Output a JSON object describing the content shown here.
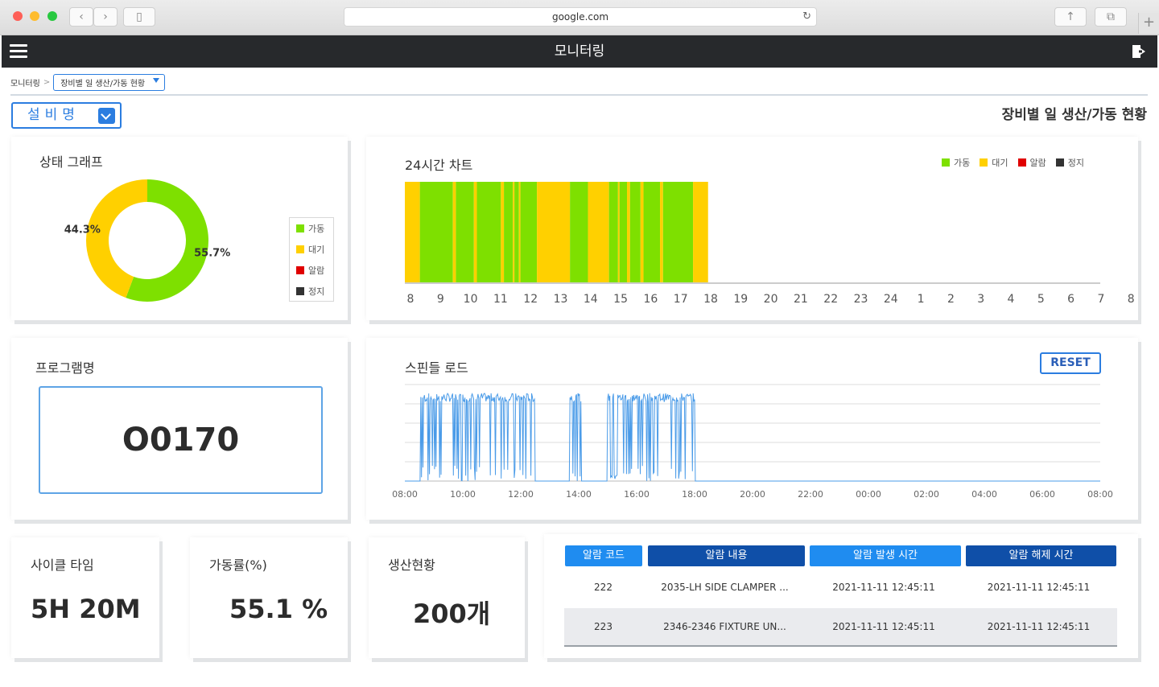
{
  "browser": {
    "url": "google.com"
  },
  "header": {
    "title": "모니터링"
  },
  "breadcrumb": {
    "root": "모니터링",
    "sep": ">",
    "current": "장비별 일 생산/가동 현황"
  },
  "equipment_select": {
    "label": "설비명"
  },
  "page_title": "장비별 일 생산/가동 현황",
  "colors": {
    "run": "#7ee000",
    "idle": "#ffd000",
    "alarm": "#e00000",
    "stop": "#333333",
    "spindle": "#4a9be8",
    "accent": "#2b7de0"
  },
  "status_graph": {
    "title": "상태 그래프",
    "legend": [
      "가동",
      "대기",
      "알람",
      "정지"
    ],
    "chart_data": {
      "type": "pie",
      "labels": [
        "가동",
        "대기"
      ],
      "values": [
        55.7,
        44.3
      ],
      "data_labels": [
        "55.7%",
        "44.3%"
      ]
    }
  },
  "chart24": {
    "title": "24시간 차트",
    "legend": [
      "가동",
      "대기",
      "알람",
      "정지"
    ],
    "chart_data": {
      "type": "bar",
      "x_ticks": [
        "8",
        "9",
        "10",
        "11",
        "12",
        "13",
        "14",
        "15",
        "16",
        "17",
        "18",
        "19",
        "20",
        "21",
        "22",
        "23",
        "24",
        "1",
        "2",
        "3",
        "4",
        "5",
        "6",
        "7",
        "8"
      ],
      "segments": [
        {
          "start": 8.0,
          "end": 8.5,
          "state": "대기"
        },
        {
          "start": 8.5,
          "end": 9.6,
          "state": "가동"
        },
        {
          "start": 9.6,
          "end": 9.7,
          "state": "대기"
        },
        {
          "start": 9.7,
          "end": 10.3,
          "state": "가동"
        },
        {
          "start": 10.3,
          "end": 10.4,
          "state": "대기"
        },
        {
          "start": 10.4,
          "end": 11.2,
          "state": "가동"
        },
        {
          "start": 11.2,
          "end": 11.3,
          "state": "대기"
        },
        {
          "start": 11.3,
          "end": 11.6,
          "state": "가동"
        },
        {
          "start": 11.6,
          "end": 11.65,
          "state": "대기"
        },
        {
          "start": 11.65,
          "end": 11.8,
          "state": "가동"
        },
        {
          "start": 11.8,
          "end": 11.85,
          "state": "대기"
        },
        {
          "start": 11.85,
          "end": 12.4,
          "state": "가동"
        },
        {
          "start": 12.4,
          "end": 13.5,
          "state": "대기"
        },
        {
          "start": 13.5,
          "end": 14.1,
          "state": "가동"
        },
        {
          "start": 14.1,
          "end": 14.8,
          "state": "대기"
        },
        {
          "start": 14.8,
          "end": 15.1,
          "state": "가동"
        },
        {
          "start": 15.1,
          "end": 15.15,
          "state": "대기"
        },
        {
          "start": 15.15,
          "end": 15.4,
          "state": "가동"
        },
        {
          "start": 15.4,
          "end": 15.5,
          "state": "대기"
        },
        {
          "start": 15.5,
          "end": 15.85,
          "state": "가동"
        },
        {
          "start": 15.85,
          "end": 15.95,
          "state": "대기"
        },
        {
          "start": 15.95,
          "end": 16.5,
          "state": "가동"
        },
        {
          "start": 16.5,
          "end": 16.6,
          "state": "대기"
        },
        {
          "start": 16.6,
          "end": 17.6,
          "state": "가동"
        },
        {
          "start": 17.6,
          "end": 18.1,
          "state": "대기"
        }
      ]
    }
  },
  "program": {
    "title": "프로그램명",
    "value": "O0170"
  },
  "spindle": {
    "title": "스핀들 로드",
    "reset_label": "RESET",
    "chart_data": {
      "type": "line",
      "x_ticks": [
        "08:00",
        "10:00",
        "12:00",
        "14:00",
        "16:00",
        "18:00",
        "20:00",
        "22:00",
        "00:00",
        "02:00",
        "04:00",
        "06:00",
        "08:00"
      ],
      "ylim": [
        0,
        5
      ],
      "active_windows": [
        [
          8.55,
          12.5
        ],
        [
          13.7,
          14.1
        ],
        [
          15.0,
          18.0
        ]
      ]
    }
  },
  "cycle_time": {
    "title": "사이클 타임",
    "value": "5H 20M"
  },
  "utilization": {
    "title": "가동률(%)",
    "value": "55.1 %"
  },
  "production": {
    "title": "생산현황",
    "value": "200개"
  },
  "alarm_table": {
    "headers": [
      "알람 코드",
      "알람 내용",
      "알람 발생 시간",
      "알람 해제 시간"
    ],
    "rows": [
      {
        "code": "222",
        "content": "2035-LH SIDE CLAMPER ...",
        "occurred": "2021-11-11  12:45:11",
        "cleared": "2021-11-11  12:45:11"
      },
      {
        "code": "223",
        "content": "2346-2346 FIXTURE UN...",
        "occurred": "2021-11-11  12:45:11",
        "cleared": "2021-11-11  12:45:11"
      }
    ]
  }
}
